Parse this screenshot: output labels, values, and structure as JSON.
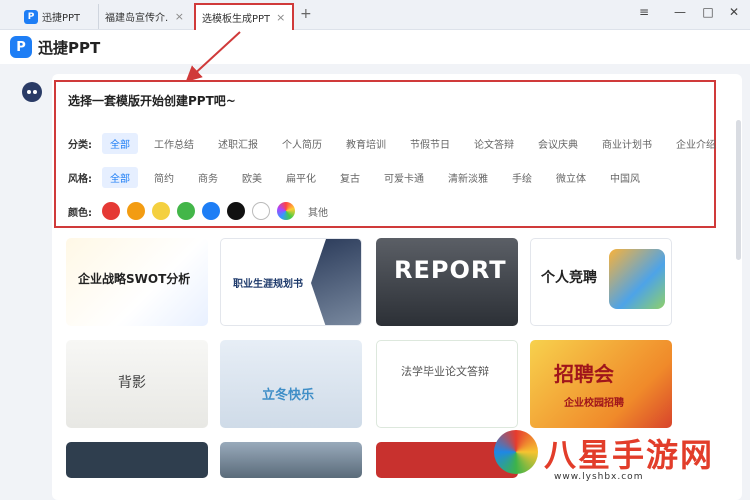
{
  "tabs": [
    {
      "label": "迅捷PPT"
    },
    {
      "label": "福建岛宣传介..."
    },
    {
      "label": "选模板生成PPT"
    }
  ],
  "tab_close_glyph": "×",
  "tab_add_glyph": "+",
  "window": {
    "menu_glyph": "≡",
    "minimize_glyph": "—",
    "maximize_glyph": "□",
    "close_glyph": "✕"
  },
  "app": {
    "logo_letter": "P",
    "name": "迅捷PPT"
  },
  "selector": {
    "title": "选择一套模版开始创建PPT吧~",
    "category_label": "分类:",
    "categories": [
      "全部",
      "工作总结",
      "述职汇报",
      "个人简历",
      "教育培训",
      "节假节日",
      "论文答辩",
      "会议庆典",
      "商业计划书",
      "企业介绍"
    ],
    "style_label": "风格:",
    "styles": [
      "全部",
      "简约",
      "商务",
      "欧美",
      "扁平化",
      "复古",
      "可爱卡通",
      "清新淡雅",
      "手绘",
      "微立体",
      "中国风"
    ],
    "color_label": "颜色:",
    "colors": [
      "#e53935",
      "#f39c12",
      "#f4d03f",
      "#43b649",
      "#1e7ef5",
      "#111111",
      "#ffffff",
      "multi"
    ],
    "other_label": "其他"
  },
  "templates": [
    {
      "title": "企业战略SWOT分析"
    },
    {
      "title": "职业生涯规划书"
    },
    {
      "title": "REPORT"
    },
    {
      "title": "个人竞聘"
    },
    {
      "title": "背影"
    },
    {
      "title": "立冬快乐"
    },
    {
      "title": "法学毕业论文答辩"
    },
    {
      "title": "招聘会",
      "subtitle": "企业校园招聘"
    }
  ],
  "accent_color": "#1e7ef5",
  "annotation_color": "#d03a3a",
  "watermark": {
    "text": "八星手游网",
    "url": "www.lyshbx.com"
  }
}
